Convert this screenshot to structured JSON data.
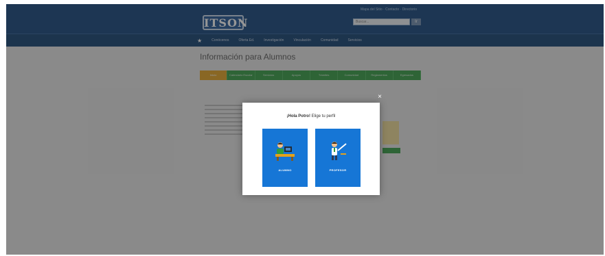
{
  "header": {
    "utility_text": "Mapa del Sitio · Contacto · Directorio",
    "logo_text": "ITSON",
    "search_placeholder": "Buscar...",
    "search_button": "Ir",
    "nav_items": [
      "Conócenos",
      "Oferta Ed.",
      "Investigación",
      "Vinculación",
      "Comunidad",
      "Servicios"
    ]
  },
  "page": {
    "title": "Información para Alumnos",
    "tabs": [
      "Inicio",
      "Calendario Escolar",
      "Servicios",
      "Apoyos",
      "Trámites",
      "Comunidad",
      "Reglamentos",
      "Egresados"
    ]
  },
  "modal": {
    "greeting": "¡Hola Potro!",
    "subtitle": " Elige tu perfil",
    "close_symbol": "×",
    "options": [
      {
        "label": "ALUMNO",
        "icon": "student-at-desk-icon"
      },
      {
        "label": "PROFESOR",
        "icon": "teacher-writing-icon"
      }
    ]
  },
  "colors": {
    "header_blue": "#0c3f78",
    "tab_green": "#2e9b3f",
    "tab_active": "#e5a11a",
    "card_blue": "#1676d6"
  }
}
